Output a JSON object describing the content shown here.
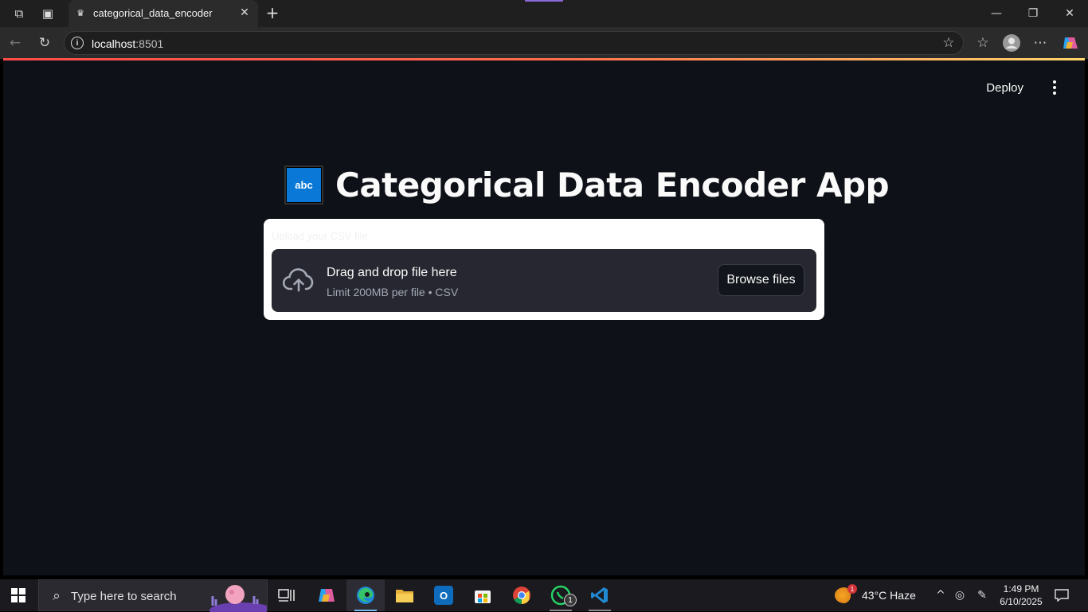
{
  "browser": {
    "tab_title": "categorical_data_encoder",
    "url_host": "localhost",
    "url_port": ":8501"
  },
  "app": {
    "deploy_label": "Deploy",
    "title_emoji_text": "abc",
    "title": "Categorical Data Encoder App",
    "uploader": {
      "label": "Upload your CSV file",
      "drop_title": "Drag and drop file here",
      "drop_subtitle": "Limit 200MB per file • CSV",
      "browse_label": "Browse files"
    }
  },
  "taskbar": {
    "search_placeholder": "Type here to search",
    "weather_badge": "1",
    "weather_text": "43°C  Haze",
    "whatsapp_badge": "1",
    "time": "1:49 PM",
    "date": "6/10/2025"
  },
  "colors": {
    "app_background": "#0e1117",
    "accent_red": "#ff4b4b",
    "dropzone": "#262730",
    "title_icon_blue": "#0a78d7"
  }
}
